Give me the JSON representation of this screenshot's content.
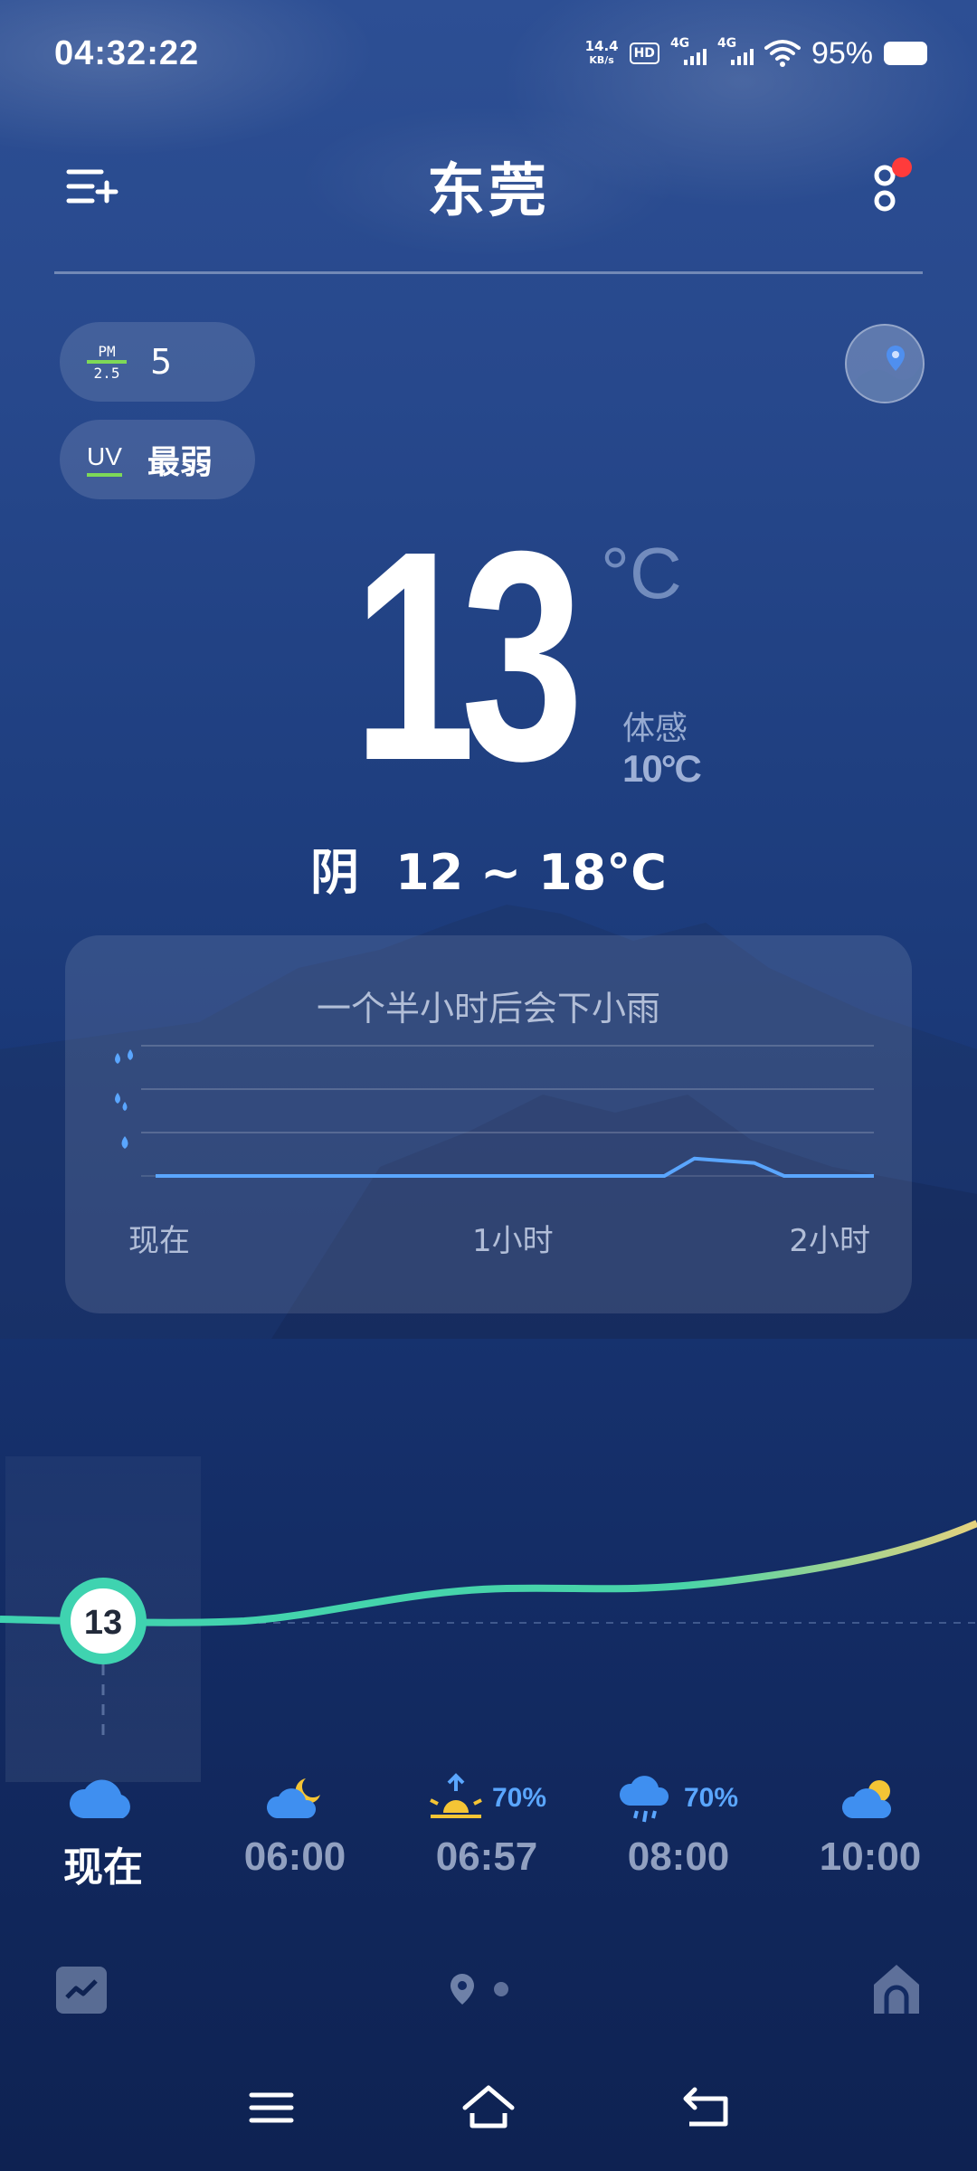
{
  "status_bar": {
    "time": "04:32:22",
    "net_speed_value": "14.4",
    "net_speed_unit": "KB/s",
    "hd_label": "HD",
    "sim1_label": "4G",
    "sim2_label": "4G",
    "battery_pct": "95%"
  },
  "header": {
    "city": "东莞"
  },
  "air": {
    "pm_top": "PM",
    "pm_bottom": "2.5",
    "pm_value": "5",
    "uv_label": "UV",
    "uv_value": "最弱"
  },
  "current": {
    "temp": "13",
    "unit": "°C",
    "feels_label": "体感",
    "feels_value": "10°C",
    "condition": "阴",
    "range": "12 ~ 18°C"
  },
  "rain_forecast": {
    "message": "一个半小时后会下小雨",
    "axis_labels": [
      "现在",
      "1小时",
      "2小时"
    ],
    "chart_data": {
      "type": "line",
      "x": [
        0,
        10,
        20,
        30,
        40,
        50,
        60,
        70,
        80,
        85,
        90,
        95,
        100,
        105,
        110,
        120
      ],
      "values": [
        0,
        0,
        0,
        0,
        0,
        0,
        0,
        0,
        0,
        0,
        0.4,
        0.35,
        0.3,
        0,
        0,
        0
      ],
      "xlabel": "",
      "ylabel": "",
      "ylim": [
        0,
        3
      ]
    }
  },
  "hourly": {
    "now_temp": "13",
    "temps": [
      13,
      13,
      14,
      15,
      17
    ],
    "items": [
      {
        "time": "现在",
        "icon": "cloud-icon",
        "pct": ""
      },
      {
        "time": "06:00",
        "icon": "cloud-moon-icon",
        "pct": ""
      },
      {
        "time": "06:57",
        "icon": "sunrise-icon",
        "pct": "70%"
      },
      {
        "time": "08:00",
        "icon": "rain-cloud-icon",
        "pct": "70%"
      },
      {
        "time": "10:00",
        "icon": "cloud-sun-icon",
        "pct": ""
      }
    ]
  },
  "colors": {
    "temp_line_start": "#3fd3b0",
    "temp_line_end": "#e6d27e",
    "precip": "#5aa6ff",
    "alert_dot": "#ff3b3b"
  }
}
